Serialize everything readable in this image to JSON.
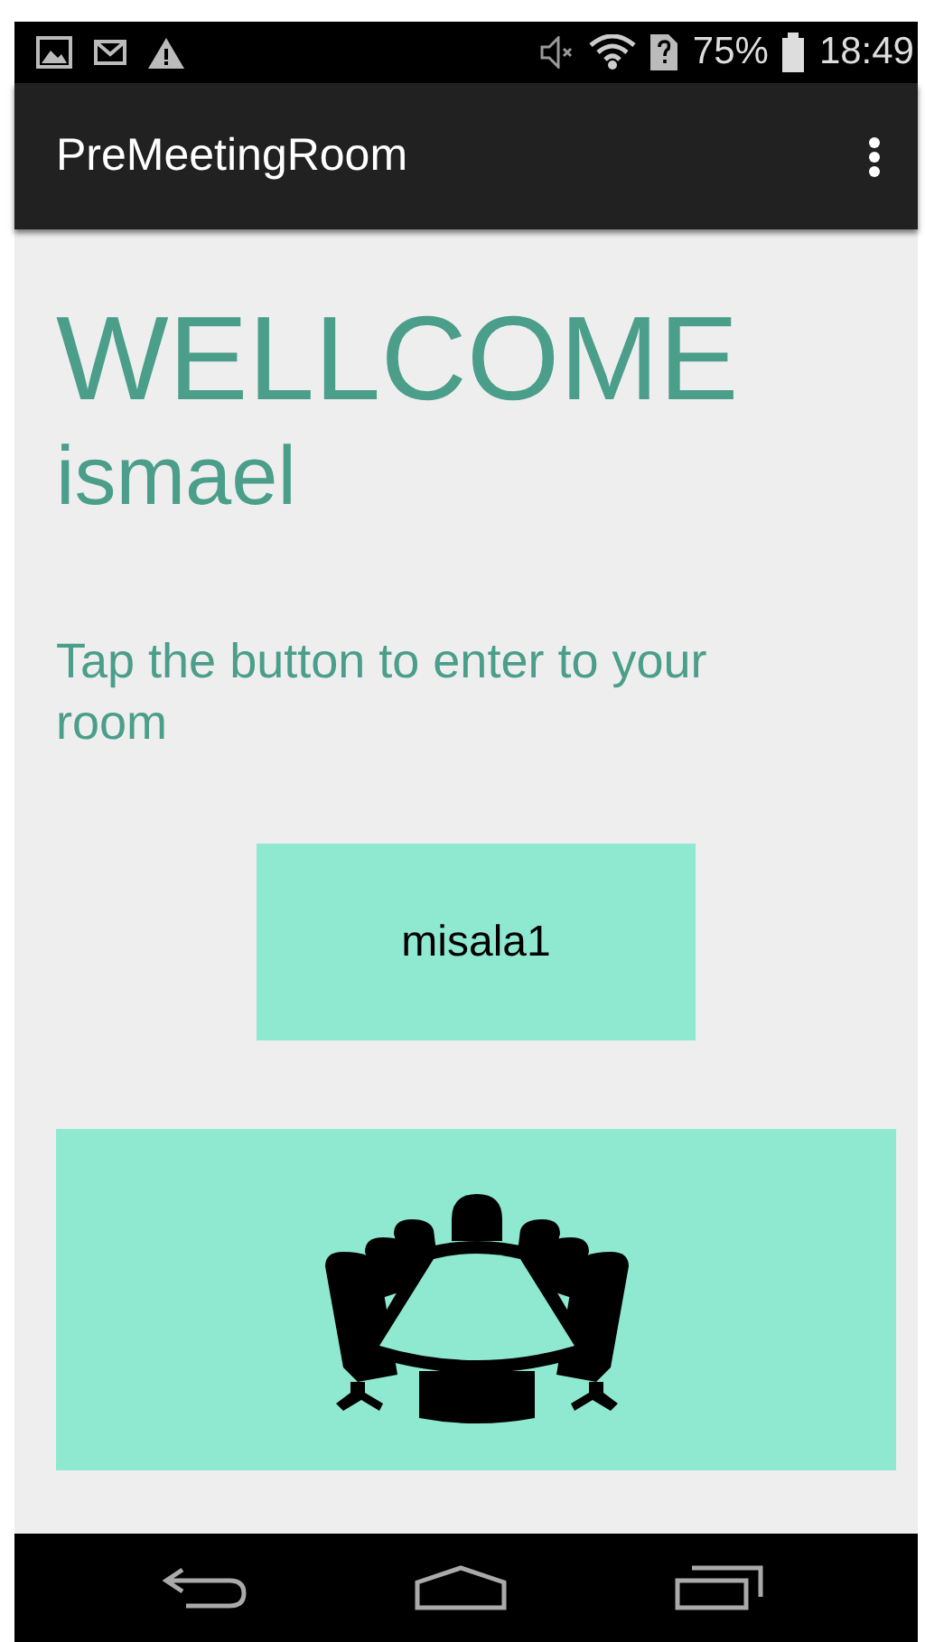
{
  "status_bar": {
    "battery": "75%",
    "time": "18:49"
  },
  "app_bar": {
    "title": "PreMeetingRoom"
  },
  "content": {
    "heading": "WELLCOME",
    "user_name": "ismael",
    "instruction": "Tap the button to enter to your room",
    "room_button": "misala1"
  }
}
